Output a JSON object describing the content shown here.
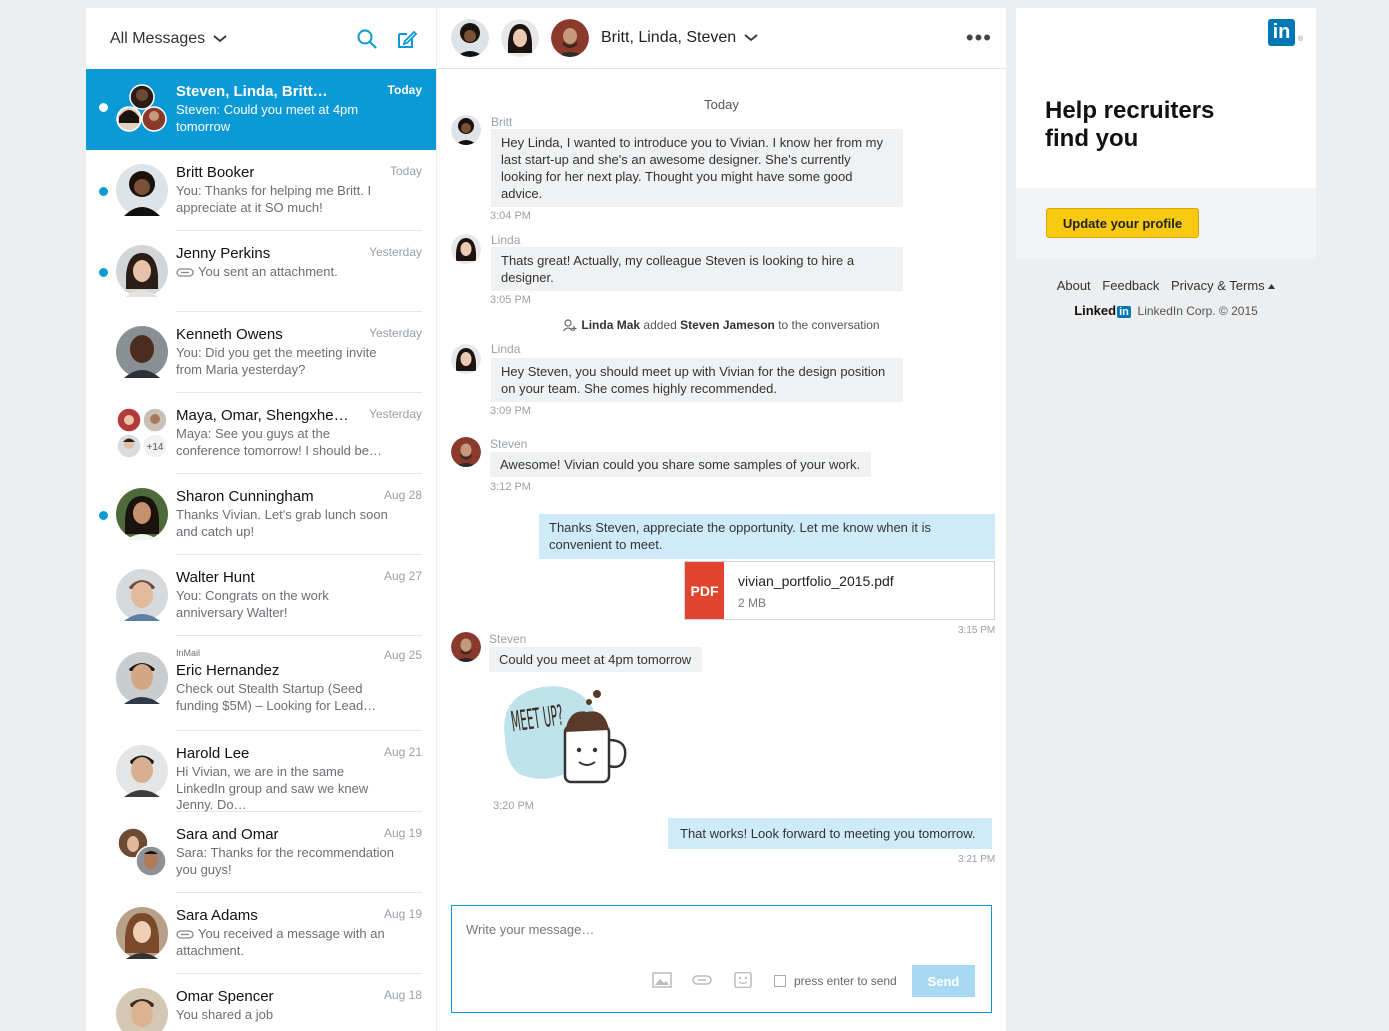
{
  "left": {
    "title": "All Messages",
    "conversations": [
      {
        "name": "Steven, Linda, Britt…",
        "date": "Today",
        "snippet": "Steven: Could you meet at 4pm tomorrow",
        "unread": true,
        "selected": true
      },
      {
        "name": "Britt Booker",
        "date": "Today",
        "snippet": "You: Thanks for helping me Britt. I appreciate at it SO much!",
        "unread": true
      },
      {
        "name": "Jenny Perkins",
        "date": "Yesterday",
        "snippet": "You sent an attachment.",
        "unread": true,
        "attachment": true
      },
      {
        "name": "Kenneth Owens",
        "date": "Yesterday",
        "snippet": "You: Did you get the meeting invite from Maria yesterday?",
        "unread": false
      },
      {
        "name": "Maya, Omar, Shengxhe…",
        "date": "Yesterday",
        "snippet": "Maya: See you guys at the conference tomorrow! I should be…",
        "unread": false,
        "extra_count": "+14"
      },
      {
        "name": "Sharon Cunningham",
        "date": "Aug 28",
        "snippet": "Thanks Vivian. Let's grab lunch soon and catch up!",
        "unread": true
      },
      {
        "name": "Walter Hunt",
        "date": "Aug 27",
        "snippet": "You: Congrats on the work anniversary Walter!",
        "unread": false
      },
      {
        "name": "Eric Hernandez",
        "date": "Aug 25",
        "snippet": "Check out Stealth Startup (Seed funding $5M) – Looking for Lead…",
        "unread": false,
        "tag": "InMail"
      },
      {
        "name": "Harold Lee",
        "date": "Aug 21",
        "snippet": "Hi Vivian, we are in the same LinkedIn group and saw we knew Jenny. Do…",
        "unread": false
      },
      {
        "name": "Sara and Omar",
        "date": "Aug 19",
        "snippet": "Sara: Thanks for the recommendation you guys!",
        "unread": false
      },
      {
        "name": "Sara Adams",
        "date": "Aug 19",
        "snippet": "You received a message with an attachment.",
        "unread": false,
        "attachment": true
      },
      {
        "name": "Omar Spencer",
        "date": "Aug 18",
        "snippet": "You shared a job",
        "unread": false
      }
    ]
  },
  "chat": {
    "title": "Britt, Linda, Steven",
    "more_label": "•••",
    "day_label": "Today",
    "messages": [
      {
        "sender": "Britt",
        "text": "Hey Linda, I wanted to introduce you to Vivian. I know her from my last start-up and she's an awesome designer. She's currently looking for her next play. Thought you might have some good advice.",
        "time": "3:04 PM"
      },
      {
        "sender": "Linda",
        "text": "Thats great! Actually, my colleague Steven is looking to hire a designer.",
        "time": "3:05 PM"
      },
      {
        "sender": "Linda",
        "text": "Hey Steven, you should meet up with Vivian for the design position on your team. She comes highly recommended.",
        "time": "3:09 PM"
      },
      {
        "sender": "Steven",
        "text": "Awesome! Vivian could you share some samples of your work.",
        "time": "3:12 PM"
      },
      {
        "sender": "me",
        "text": "Thanks Steven, appreciate the opportunity. Let me know when it is convenient to meet.",
        "time": "3:15 PM"
      },
      {
        "sender": "Steven",
        "text": "Could you meet at 4pm tomorrow",
        "time": "3:20 PM"
      },
      {
        "sender": "me",
        "text": "That works! Look forward to meeting you tomorrow.",
        "time": "3:21 PM"
      }
    ],
    "system": {
      "actor": "Linda Mak",
      "verb": "added",
      "target": "Steven Jameson",
      "suffix": "to the conversation"
    },
    "attachment": {
      "type": "PDF",
      "name": "vivian_portfolio_2015.pdf",
      "size": "2 MB"
    },
    "sticker_text": "MEET UP?",
    "composer": {
      "placeholder": "Write your message…",
      "enter_label": "press enter to send",
      "send_label": "Send"
    }
  },
  "ad": {
    "logo": "in",
    "reg": "®",
    "headline": "Help recruiters find you",
    "cta": "Update your profile"
  },
  "footer": {
    "links": [
      "About",
      "Feedback",
      "Privacy & Terms"
    ],
    "brand": "Linked",
    "brand_in": "in",
    "copyright": "LinkedIn Corp. © 2015"
  },
  "colors": {
    "accent": "#0b9ad6",
    "linkedin": "#0077b5",
    "cta": "#f7c911",
    "pdf": "#e2452e"
  }
}
